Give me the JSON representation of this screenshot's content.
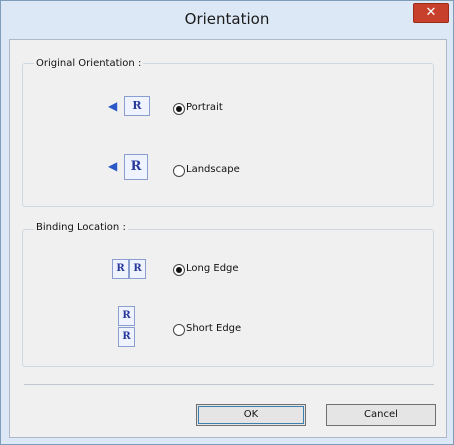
{
  "dialog": {
    "title": "Orientation",
    "close_symbol": "✕"
  },
  "original_orientation": {
    "label": "Original Orientation :",
    "options": [
      {
        "label": "Portrait",
        "checked": true,
        "icon": "portrait-orientation-icon"
      },
      {
        "label": "Landscape",
        "checked": false,
        "icon": "landscape-orientation-icon"
      }
    ]
  },
  "binding_location": {
    "label": "Binding Location :",
    "options": [
      {
        "label": "Long Edge",
        "checked": true,
        "icon": "long-edge-binding-icon"
      },
      {
        "label": "Short Edge",
        "checked": false,
        "icon": "short-edge-binding-icon"
      }
    ]
  },
  "icons": {
    "page_letter": "R",
    "arrow": "◀"
  },
  "buttons": {
    "ok": "OK",
    "cancel": "Cancel"
  }
}
